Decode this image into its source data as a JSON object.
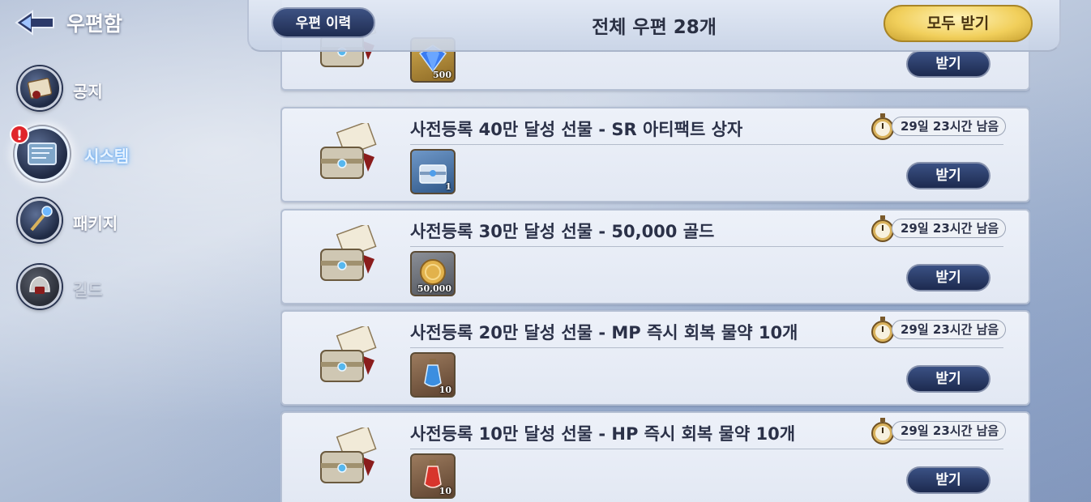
{
  "sidebar": {
    "title": "우편함",
    "categories": [
      {
        "label": "공지",
        "icon": "letter-seal-icon"
      },
      {
        "label": "시스템",
        "icon": "treasure-map-icon",
        "active": true,
        "badge": "!"
      },
      {
        "label": "패키지",
        "icon": "magic-staff-icon"
      },
      {
        "label": "길드",
        "icon": "guild-helmet-icon",
        "disabled": true
      }
    ]
  },
  "header": {
    "history_label": "우편 이력",
    "total_label": "전체 우편 28개",
    "claim_all_label": "모두 받기"
  },
  "mails": [
    {
      "title": "",
      "timer": "",
      "reward_qty": "500",
      "reward_icon": "diamond-icon",
      "claim_label": "받기"
    },
    {
      "title": "사전등록 40만 달성 선물 - SR 아티팩트 상자",
      "timer": "29일 23시간 남음",
      "reward_qty": "1",
      "reward_icon": "sr-artifact-box-icon",
      "claim_label": "받기"
    },
    {
      "title": "사전등록 30만 달성 선물 - 50,000 골드",
      "timer": "29일 23시간 남음",
      "reward_qty": "50,000",
      "reward_icon": "gold-coin-icon",
      "claim_label": "받기"
    },
    {
      "title": "사전등록 20만 달성 선물 - MP 즉시 회복 물약 10개",
      "timer": "29일 23시간 남음",
      "reward_qty": "10",
      "reward_icon": "mp-potion-icon",
      "claim_label": "받기"
    },
    {
      "title": "사전등록 10만 달성 선물 - HP 즉시 회복 물약 10개",
      "timer": "29일 23시간 남음",
      "reward_qty": "10",
      "reward_icon": "hp-potion-icon",
      "claim_label": "받기"
    }
  ],
  "colors": {
    "navy_button": "#1f2c51",
    "gold_button": "#f1cf5b",
    "card_bg": "#e6ebf5",
    "alert": "#e0252b"
  }
}
